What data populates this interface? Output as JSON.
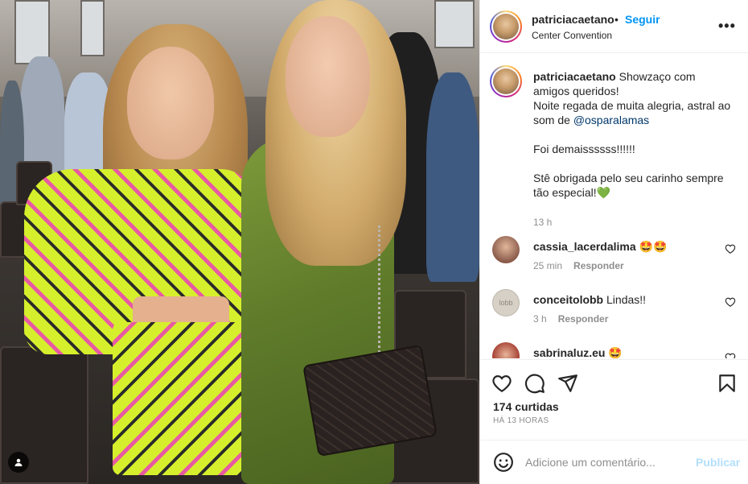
{
  "post": {
    "author": "patriciacaetano",
    "separator": "•",
    "follow_label": "Seguir",
    "location": "Center Convention",
    "more_label": "•••"
  },
  "caption": {
    "username": "patriciacaetano",
    "line1": "Showzaço com amigos queridos!",
    "line2": "Noite regada de muita alegria, astral ao som de ",
    "mention": "@osparalamas",
    "line3": "Foi demaissssss!!!!!!",
    "line4": "Stê obrigada pelo seu carinho sempre tão especial!",
    "emoji": "💚",
    "time": "13 h"
  },
  "comments": [
    {
      "username": "cassia_lacerdalima",
      "text": "🤩🤩",
      "time": "25 min",
      "reply_label": "Responder",
      "avatar_color": "#8a5a4a"
    },
    {
      "username": "conceitolobb",
      "text": "Lindas!!",
      "time": "3 h",
      "reply_label": "Responder",
      "avatar_color": "#c9c2b8",
      "avatar_text": "lobb"
    },
    {
      "username": "sabrinaluz.eu",
      "text": "🤩",
      "time": "",
      "reply_label": "",
      "avatar_color": "#a84438"
    }
  ],
  "actions": {
    "likes": "174 curtidas",
    "date": "HÁ 13 HORAS"
  },
  "compose": {
    "placeholder": "Adicione um comentário...",
    "publish_label": "Publicar"
  }
}
